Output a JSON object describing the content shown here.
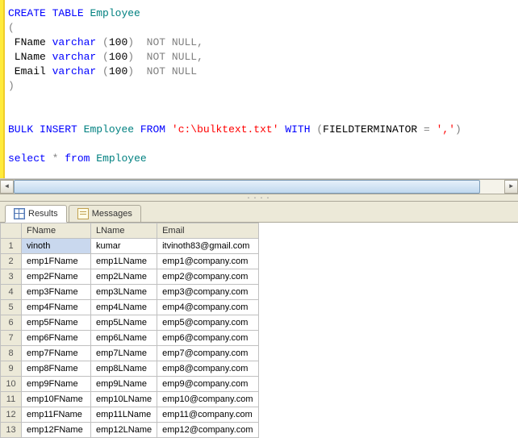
{
  "code": {
    "line1": {
      "a": "CREATE",
      "b": " ",
      "c": "TABLE",
      "d": " Employee"
    },
    "line2": "(",
    "line3": {
      "a": " FName ",
      "b": "varchar",
      "c": " ",
      "d": "(",
      "e": "100",
      "f": ")",
      "g": "  ",
      "h": "NOT",
      "i": " ",
      "j": "NULL",
      "k": ","
    },
    "line4": {
      "a": " LName ",
      "b": "varchar",
      "c": " ",
      "d": "(",
      "e": "100",
      "f": ")",
      "g": "  ",
      "h": "NOT",
      "i": " ",
      "j": "NULL",
      "k": ","
    },
    "line5": {
      "a": " Email ",
      "b": "varchar",
      "c": " ",
      "d": "(",
      "e": "100",
      "f": ")",
      "g": "  ",
      "h": "NOT",
      "i": " ",
      "j": "NULL"
    },
    "line6": ")",
    "line9": {
      "a": "BULK",
      "b": " ",
      "c": "INSERT",
      "d": " Employee ",
      "e": "FROM",
      "f": " ",
      "g": "'c:\\bulktext.txt'",
      "h": " ",
      "i": "WITH",
      "j": " ",
      "k": "(",
      "l": "FIELDTERMINATOR ",
      "m": "=",
      "n": " ",
      "o": "','",
      "p": ")"
    },
    "line11": {
      "a": "select",
      "b": " ",
      "c": "*",
      "d": " ",
      "e": "from",
      "f": " Employee"
    }
  },
  "tabs": {
    "results": "Results",
    "messages": "Messages"
  },
  "headers": {
    "fname": "FName",
    "lname": "LName",
    "email": "Email"
  },
  "rows": [
    {
      "n": "1",
      "f": "vinoth",
      "l": "kumar",
      "e": "itvinoth83@gmail.com"
    },
    {
      "n": "2",
      "f": "emp1FName",
      "l": "emp1LName",
      "e": "emp1@company.com"
    },
    {
      "n": "3",
      "f": "emp2FName",
      "l": "emp2LName",
      "e": "emp2@company.com"
    },
    {
      "n": "4",
      "f": "emp3FName",
      "l": "emp3LName",
      "e": "emp3@company.com"
    },
    {
      "n": "5",
      "f": "emp4FName",
      "l": "emp4LName",
      "e": "emp4@company.com"
    },
    {
      "n": "6",
      "f": "emp5FName",
      "l": "emp5LName",
      "e": "emp5@company.com"
    },
    {
      "n": "7",
      "f": "emp6FName",
      "l": "emp6LName",
      "e": "emp6@company.com"
    },
    {
      "n": "8",
      "f": "emp7FName",
      "l": "emp7LName",
      "e": "emp7@company.com"
    },
    {
      "n": "9",
      "f": "emp8FName",
      "l": "emp8LName",
      "e": "emp8@company.com"
    },
    {
      "n": "10",
      "f": "emp9FName",
      "l": "emp9LName",
      "e": "emp9@company.com"
    },
    {
      "n": "11",
      "f": "emp10FName",
      "l": "emp10LName",
      "e": "emp10@company.com"
    },
    {
      "n": "12",
      "f": "emp11FName",
      "l": "emp11LName",
      "e": "emp11@company.com"
    },
    {
      "n": "13",
      "f": "emp12FName",
      "l": "emp12LName",
      "e": "emp12@company.com"
    }
  ]
}
